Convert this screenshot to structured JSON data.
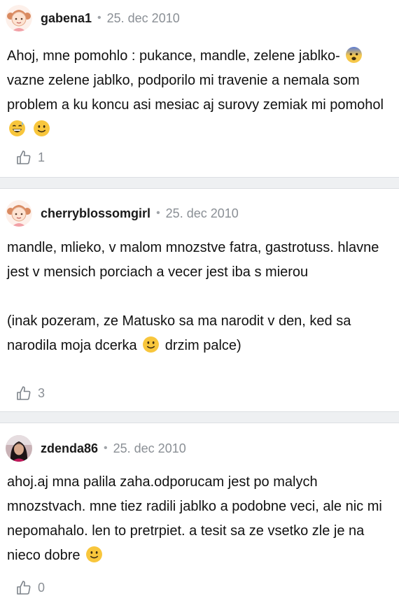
{
  "comments": [
    {
      "username": "gabena1",
      "separator": "•",
      "date": "25. dec 2010",
      "text_a": "Ahoj, mne pomohlo : pukance, mandle, zelene jablko-",
      "text_b": " vazne zelene jablko, podporilo mi travenie a nemala som problem a ku koncu asi mesiac aj surovy zemiak mi pomohol",
      "likes": "1",
      "avatar_icon": "girl-avatar-icon"
    },
    {
      "username": "cherryblossomgirl",
      "separator": "•",
      "date": "25. dec 2010",
      "text_a": "mandle, mlieko, v malom mnozstve fatra, gastrotuss. hlavne jest v mensich porciach a vecer jest iba s mierou",
      "text_b1": "(inak pozeram, ze Matusko sa ma narodit v den, ked sa narodila moja dcerka",
      "text_b2": " drzim palce)",
      "likes": "3",
      "avatar_icon": "girl-avatar-icon"
    },
    {
      "username": "zdenda86",
      "separator": "•",
      "date": "25. dec 2010",
      "text_a": "ahoj.aj mna palila zaha.odporucam jest po malych mnozstvach. mne tiez radili jablko a podobne veci, ale nic mi nepomahalo. len to pretrpiet. a tesit sa ze vsetko zle je na nieco dobre",
      "likes": "0",
      "avatar_icon": "photo-avatar-icon"
    }
  ],
  "colors": {
    "separator_bg": "#eef0f2",
    "meta_text": "#8a8f95",
    "body_text": "#111111"
  },
  "emoji_icons": [
    "fearful-face-emoji",
    "grinning-sweat-emoji",
    "slightly-smiling-emoji"
  ]
}
